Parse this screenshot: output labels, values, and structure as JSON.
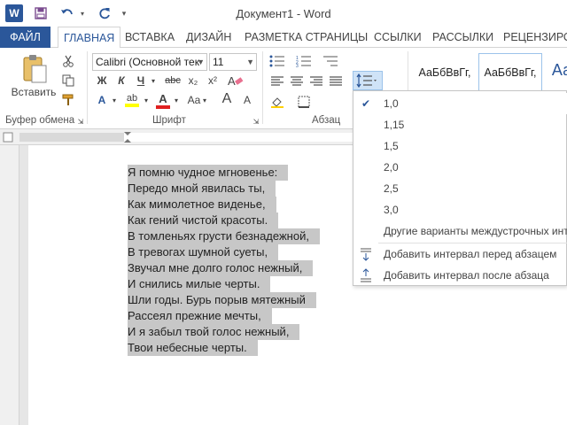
{
  "window": {
    "title": "Документ1 - Word",
    "logo": "W"
  },
  "tabs": [
    "ФАЙЛ",
    "ГЛАВНАЯ",
    "ВСТАВКА",
    "ДИЗАЙН",
    "РАЗМЕТКА СТРАНИЦЫ",
    "ССЫЛКИ",
    "РАССЫЛКИ",
    "РЕЦЕНЗИРОВ"
  ],
  "ribbon": {
    "paste_label": "Вставить",
    "font_name": "Calibri (Основной тек",
    "font_size": "11",
    "groups": {
      "clipboard": "Буфер обмена",
      "font": "Шрифт",
      "paragraph": "Абзац"
    },
    "style_sample_1": "АаБбВвГг,",
    "style_sample_2": "АаБбВвГг,",
    "style_sample_3": "Аа",
    "font_buttons": {
      "bold": "Ж",
      "italic": "К",
      "underline": "Ч",
      "strike": "abc",
      "sub": "x₂",
      "sup": "x²",
      "grow": "A",
      "shrink": "A",
      "case": "Aa",
      "highlight": "ab",
      "color": "A"
    }
  },
  "document_lines": [
    "Я помню чудное мгновенье:",
    "Передо мной явилась ты,",
    "Как мимолетное виденье,",
    "Как гений чистой красоты.",
    "В томленьях грусти безнадежной,",
    "В тревогах шумной суеты,",
    "Звучал мне долго голос нежный,",
    "И снились милые черты.",
    "Шли годы. Бурь порыв мятежный",
    "Рассеял прежние мечты,",
    "И я забыл твой голос нежный,",
    "Твои небесные черты."
  ],
  "line_spacing_menu": {
    "options": [
      "1,0",
      "1,15",
      "1,5",
      "2,0",
      "2,5",
      "3,0"
    ],
    "selected": "1,0",
    "more": "Другие варианты междустрочных интервалов...",
    "add_before": "Добавить интервал перед абзацем",
    "add_after": "Добавить интервал после абзаца"
  },
  "colors": {
    "accent": "#2b579a",
    "highlight": "#c7c7c7"
  }
}
